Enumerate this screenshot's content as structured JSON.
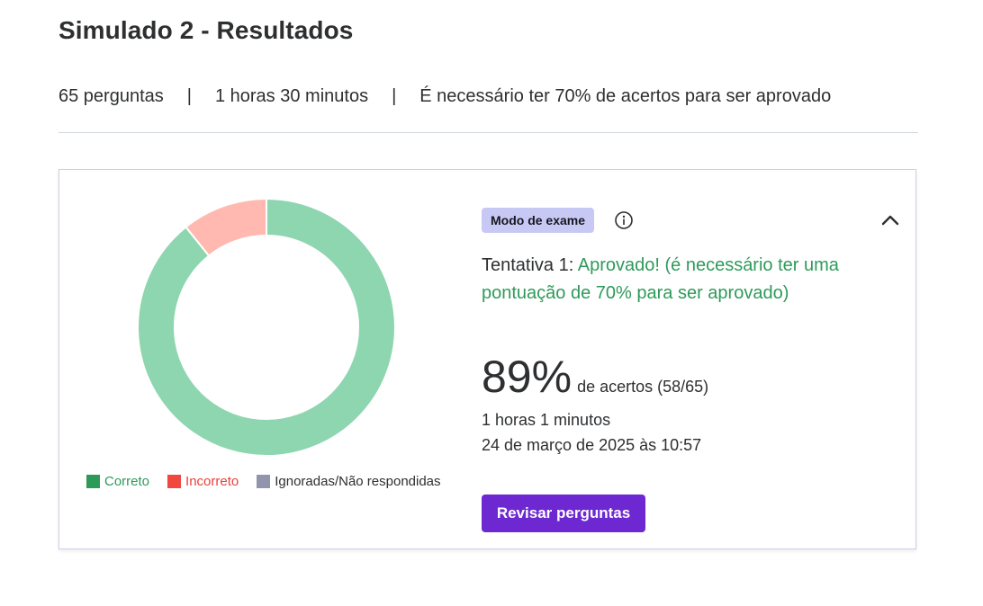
{
  "header": {
    "title": "Simulado 2 - Resultados",
    "question_count": "65 perguntas",
    "separator": "|",
    "duration": "1 horas 30 minutos",
    "pass_requirement": "É necessário ter 70% de acertos para ser aprovado"
  },
  "result_card": {
    "mode_badge": "Modo de exame",
    "info_icon": "info-icon",
    "collapse_icon": "chevron-up-icon",
    "attempt_label": "Tentativa 1:",
    "attempt_status": "Aprovado! (é necessário ter uma pontuação de 70% para ser aprovado)",
    "score_percent": "89%",
    "score_detail": "de acertos (58/65)",
    "time_taken": "1 horas 1 minutos",
    "date": "24 de março de 2025 às 10:57",
    "review_button": "Revisar perguntas"
  },
  "chart_data": {
    "type": "pie",
    "variant": "donut",
    "categories": [
      "Correto",
      "Incorreto",
      "Ignoradas/Não respondidas"
    ],
    "values": [
      58,
      7,
      0
    ],
    "colors": [
      "#8ed6b0",
      "#ffb9b0",
      "#9194ac"
    ],
    "legend": {
      "placement": "bottom",
      "entries": [
        {
          "label": "Correto",
          "color": "#2e9a5a",
          "text_color": "#2e9a5a"
        },
        {
          "label": "Incorreto",
          "color": "#f0483e",
          "text_color": "#e8413a"
        },
        {
          "label": "Ignoradas/Não respondidas",
          "color": "#9194ac",
          "text_color": "#2d2f31"
        }
      ]
    }
  }
}
